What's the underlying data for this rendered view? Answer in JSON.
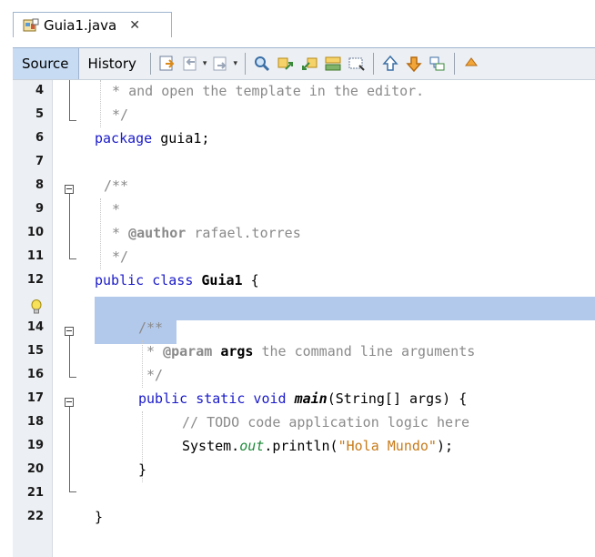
{
  "tab": {
    "title": "Guia1.java",
    "close": "✕"
  },
  "toolbar": {
    "source_label": "Source",
    "history_label": "History",
    "icons": [
      "last-edit-icon",
      "back-icon",
      "forward-icon",
      "find-icon",
      "find-previous-icon",
      "find-next-icon",
      "toggle-highlight-icon",
      "find-selection-icon",
      "previous-bookmark-icon",
      "next-bookmark-icon",
      "toggle-bookmark-icon",
      "shift-icon"
    ]
  },
  "editor": {
    "colors": {
      "keyword": "#1b1bc9",
      "comment": "#8a8a8a",
      "string": "#c77b1a",
      "field": "#1e8a3a",
      "selection": "#b3c9eb"
    },
    "lines": [
      {
        "num": "4",
        "parts": [
          {
            "t": " * and open the template in the editor.",
            "c": "cmt"
          }
        ],
        "indent": 1
      },
      {
        "num": "5",
        "parts": [
          {
            "t": " */",
            "c": "cmt"
          }
        ],
        "indent": 1
      },
      {
        "num": "6",
        "parts": [
          {
            "t": "package",
            "c": "kw"
          },
          {
            "t": " guia1;",
            "c": ""
          }
        ],
        "indent": 0
      },
      {
        "num": "7",
        "parts": [],
        "indent": 0
      },
      {
        "num": "8",
        "parts": [
          {
            "t": "/**",
            "c": "cmt"
          }
        ],
        "indent": 1
      },
      {
        "num": "9",
        "parts": [
          {
            "t": " *",
            "c": "cmt"
          }
        ],
        "indent": 1
      },
      {
        "num": "10",
        "parts": [
          {
            "t": " * ",
            "c": "cmt"
          },
          {
            "t": "@author",
            "c": "cmt bold"
          },
          {
            "t": " rafael.torres",
            "c": "cmt"
          }
        ],
        "indent": 1
      },
      {
        "num": "11",
        "parts": [
          {
            "t": " */",
            "c": "cmt"
          }
        ],
        "indent": 1
      },
      {
        "num": "12",
        "parts": [
          {
            "t": "public class",
            "c": "kw"
          },
          {
            "t": " ",
            "c": ""
          },
          {
            "t": "Guia1",
            "c": "bold"
          },
          {
            "t": " {",
            "c": ""
          }
        ],
        "indent": 0
      },
      {
        "num": "",
        "parts": [],
        "indent": 0
      },
      {
        "num": "14",
        "parts": [
          {
            "t": "/**",
            "c": "cmt"
          }
        ],
        "indent": 2
      },
      {
        "num": "15",
        "parts": [
          {
            "t": " * ",
            "c": "cmt"
          },
          {
            "t": "@param",
            "c": "cmt bold"
          },
          {
            "t": " ",
            "c": "cmt"
          },
          {
            "t": "args",
            "c": "bold"
          },
          {
            "t": " the command line arguments",
            "c": "cmt"
          }
        ],
        "indent": 2
      },
      {
        "num": "16",
        "parts": [
          {
            "t": " */",
            "c": "cmt"
          }
        ],
        "indent": 2
      },
      {
        "num": "17",
        "parts": [
          {
            "t": "public static void",
            "c": "kw"
          },
          {
            "t": " ",
            "c": ""
          },
          {
            "t": "main",
            "c": "bi"
          },
          {
            "t": "(String[] args) {",
            "c": ""
          }
        ],
        "indent": 2
      },
      {
        "num": "18",
        "parts": [
          {
            "t": "// TODO code application logic here",
            "c": "cmt"
          }
        ],
        "indent": 3
      },
      {
        "num": "19",
        "parts": [
          {
            "t": "System.",
            "c": ""
          },
          {
            "t": "out",
            "c": "fld"
          },
          {
            "t": ".println(",
            "c": ""
          },
          {
            "t": "\"Hola Mundo\"",
            "c": "str"
          },
          {
            "t": ");",
            "c": ""
          }
        ],
        "indent": 3
      },
      {
        "num": "20",
        "parts": [
          {
            "t": "}",
            "c": ""
          }
        ],
        "indent": 2
      },
      {
        "num": "21",
        "parts": [],
        "indent": 0
      },
      {
        "num": "22",
        "parts": [
          {
            "t": "}",
            "c": ""
          }
        ],
        "indent": 0
      }
    ]
  }
}
